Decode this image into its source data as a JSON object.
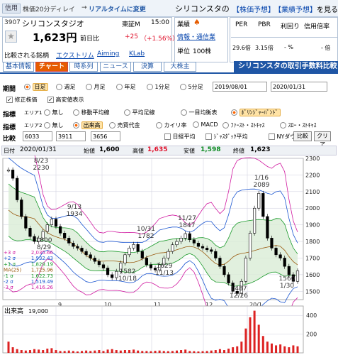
{
  "header": {
    "tag": "信用",
    "delay_note": "株価20分ディレイ",
    "arrow": "→",
    "realtime_link": "リアルタイムに変更",
    "company_title": "シリコンスタの",
    "link1": "【株価予想】",
    "link2": "【業績予想】",
    "link3": "を見る"
  },
  "stock": {
    "code": "3907",
    "name": "シリコンスタジオ",
    "market": "東証M",
    "time": "15:00",
    "price": "1,623円",
    "prev_label": "前日比",
    "change": "+25",
    "change_pct": "（+1.56%）"
  },
  "info": {
    "rating_label": "業績",
    "sector": "情報・通信業",
    "unit_label": "単位",
    "unit": "100株",
    "compare_label": "比較される銘柄",
    "peers": [
      "エクストリム",
      "Aiming",
      "KLab"
    ]
  },
  "metrics": {
    "headers": [
      "PER",
      "PBR",
      "利回り",
      "信用倍率"
    ],
    "values": [
      "29.6倍",
      "3.15倍",
      "- %",
      "- 倍"
    ]
  },
  "tabs": [
    "基本情報",
    "チャート",
    "時系列",
    "ニュース",
    "決算",
    "大株主"
  ],
  "banner": "シリコンスタの取引手数料比較",
  "controls": {
    "period_label": "期間",
    "periods": [
      "日足",
      "週足",
      "月足",
      "年足",
      "1分足",
      "5分足"
    ],
    "date_from": "2019/08/01",
    "date_to": "2020/01/31",
    "check1": "修正株価",
    "check2": "高安値表示",
    "ind1_label": "指標",
    "ind1_area": "エリア1",
    "ind1_opts": [
      "無し",
      "移動平均線",
      "平均足線",
      "一目均衡表",
      "ﾎﾞﾘﾝｼﾞｬｰﾊﾞﾝﾄﾞ"
    ],
    "ind2_label": "指標",
    "ind2_area": "エリア2",
    "ind2_opts": [
      "無し",
      "出来高",
      "売買代金",
      "カイリ率",
      "MACD",
      "ﾌｧｰｽﾄ・ｽﾄｷｬｽ",
      "ｽﾛｰ・ｽﾄｷｬｽ"
    ],
    "cmp_label": "比較",
    "cmp_codes": [
      "6033",
      "3911",
      "3656"
    ],
    "cmp_checks": [
      "日経平均",
      "ｼﾞｬｽﾀﾞｯｸ平均",
      "NYダウ"
    ],
    "cmp_btn": "比較",
    "clear_btn": "クリア"
  },
  "ohlc": {
    "d_label": "日付",
    "date": "2020/01/31",
    "o_label": "始値",
    "open": "1,600",
    "h_label": "高値",
    "high": "1,635",
    "l_label": "安値",
    "low": "1,598",
    "c_label": "終値",
    "close": "1,623"
  },
  "colors": {
    "high": "#e0102a",
    "low": "#0a8a20",
    "accent": "#e65c00",
    "blue": "#1f56a5"
  },
  "chart_data": {
    "type": "line",
    "title": "",
    "y_ticks": [
      "2300",
      "2200",
      "2100",
      "2000",
      "1900",
      "1800",
      "1700",
      "1600",
      "1500"
    ],
    "ylim": [
      1450,
      2300
    ],
    "x_ticks": [
      "9",
      "10",
      "11",
      "12",
      "20/1"
    ],
    "annotations": [
      {
        "date": "8/23",
        "value": "2230",
        "y": 2230
      },
      {
        "date": "9/13",
        "value": "1934",
        "y": 1934
      },
      {
        "date": "1800",
        "value": "8/29",
        "y": 1800
      },
      {
        "date": "10/31",
        "value": "1782",
        "y": 1782
      },
      {
        "date": "11/27",
        "value": "1847",
        "y": 1847
      },
      {
        "date": "1/16",
        "value": "2089",
        "y": 2089
      },
      {
        "date": "1582",
        "value": "10/18",
        "y": 1582
      },
      {
        "date": "1629",
        "value": "11/13",
        "y": 1629
      },
      {
        "date": "1487",
        "value": "12/26",
        "y": 1487
      },
      {
        "date": "1560",
        "value": "1/30",
        "y": 1560
      }
    ],
    "legend": [
      {
        "label": "+3 σ",
        "value": "2,035.66",
        "color": "#d01aa0"
      },
      {
        "label": "+2 σ",
        "value": "1,932.43",
        "color": "#1a55d0"
      },
      {
        "label": "+1 σ",
        "value": "1,829.19",
        "color": "#1a9a2a"
      },
      {
        "label": "MA(25)",
        "value": "1,725.96",
        "color": "#9a5a10"
      },
      {
        "label": "-1 σ",
        "value": "1,622.73",
        "color": "#1a9a2a"
      },
      {
        "label": "-2 σ",
        "value": "1,519.49",
        "color": "#1a55d0"
      },
      {
        "label": "-3 σ",
        "value": "1,416.26",
        "color": "#d01aa0"
      }
    ],
    "series": [
      {
        "values": [
          2230,
          2180,
          2050,
          1950,
          1880,
          1830,
          1800,
          1820,
          1860,
          1900,
          1934,
          1890,
          1850,
          1820,
          1790,
          1770,
          1760,
          1740,
          1720,
          1700,
          1680,
          1660,
          1640,
          1600,
          1582,
          1620,
          1670,
          1720,
          1760,
          1782,
          1740,
          1700,
          1660,
          1640,
          1629,
          1660,
          1700,
          1740,
          1780,
          1800,
          1820,
          1847,
          1810,
          1790,
          1770,
          1760,
          1750,
          1740,
          1700,
          1650,
          1600,
          1550,
          1500,
          1487,
          1560,
          1700,
          1850,
          2000,
          2089,
          1950,
          1820,
          1760,
          1720,
          1700,
          1650,
          1600,
          1560,
          1623
        ]
      }
    ],
    "volume": {
      "label": "出来高",
      "value": "19,000",
      "y_ticks": [
        "400",
        "200"
      ],
      "ylim": [
        0,
        500
      ],
      "values": [
        120,
        60,
        40,
        30,
        25,
        30,
        40,
        35,
        30,
        45,
        50,
        30,
        20,
        20,
        25,
        20,
        15,
        20,
        25,
        20,
        25,
        30,
        20,
        35,
        40,
        30,
        25,
        30,
        30,
        35,
        25,
        20,
        20,
        18,
        22,
        25,
        20,
        18,
        20,
        25,
        30,
        35,
        20,
        18,
        15,
        18,
        20,
        25,
        30,
        40,
        30,
        45,
        60,
        70,
        120,
        260,
        380,
        450,
        300,
        180,
        120,
        100,
        80,
        90,
        70,
        60,
        80,
        70
      ]
    }
  }
}
